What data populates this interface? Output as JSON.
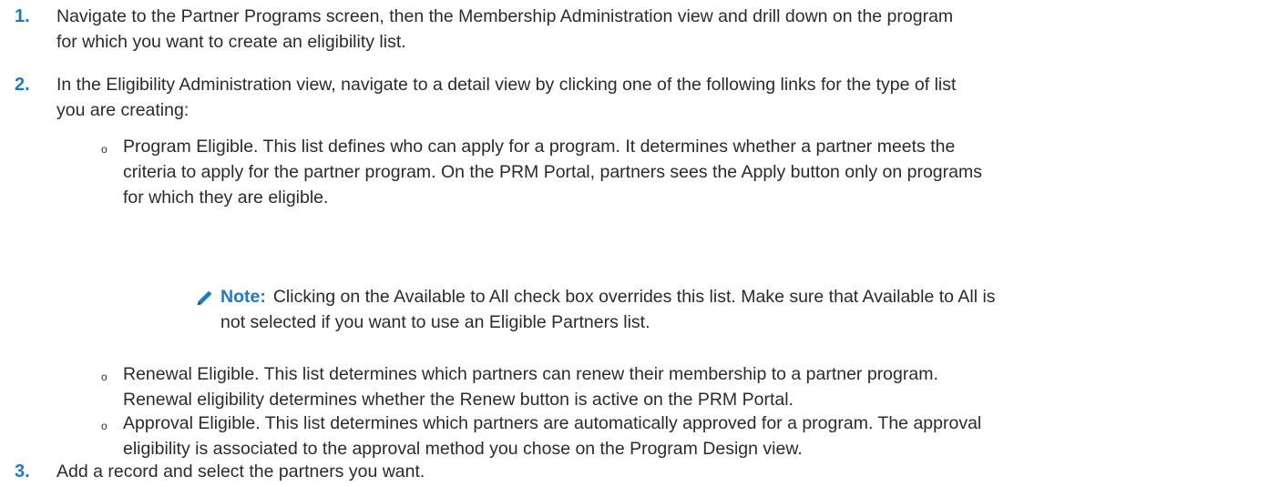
{
  "steps": [
    {
      "num": "1.",
      "line1": "Navigate to the Partner Programs screen, then the Membership Administration view and drill down on the program",
      "line2": "for which you want to create an eligibility list."
    },
    {
      "num": "2.",
      "line1": "In the Eligibility Administration view, navigate to a detail view by clicking one of the following links for the type of list",
      "line2": "you are creating:"
    },
    {
      "num": "3.",
      "line1": "Add a record and select the partners you want."
    }
  ],
  "bullets": [
    {
      "mark": "o",
      "lines": [
        "Program Eligible. This list defines who can apply for a program. It determines whether a partner meets the",
        "criteria to apply for the partner program. On the PRM Portal, partners sees the Apply button only on programs",
        "for which they are eligible."
      ]
    },
    {
      "mark": "o",
      "lines": [
        "Renewal Eligible. This list determines which partners can renew their membership to a partner program.",
        "Renewal eligibility determines whether the Renew button is active on the PRM Portal."
      ]
    },
    {
      "mark": "o",
      "lines": [
        "Approval Eligible. This list determines which partners are automatically approved for a program. The approval",
        "eligibility is associated to the approval method you chose on the Program Design view."
      ]
    }
  ],
  "note": {
    "icon": "pencil-icon",
    "label": "Note:",
    "line1": "Clicking on the Available to All check box overrides this list. Make sure that Available to All is",
    "line2": "not selected if you want to use an Eligible Partners list."
  },
  "colors": {
    "accent": "#1f7ac4",
    "text": "#2b2b2b"
  }
}
